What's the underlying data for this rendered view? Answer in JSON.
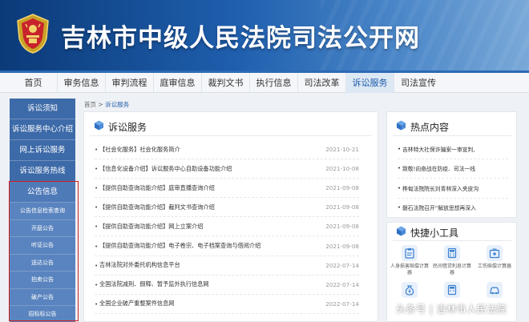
{
  "header": {
    "site_title": "吉林市中级人民法院司法公开网"
  },
  "nav": {
    "items": [
      "首页",
      "审务信息",
      "审判流程",
      "庭审信息",
      "裁判文书",
      "执行信息",
      "司法改革",
      "诉讼服务",
      "司法宣传"
    ],
    "active_index": 7
  },
  "sidebar": {
    "items": [
      "诉讼须知",
      "诉讼服务中心介绍",
      "网上诉讼服务",
      "诉讼服务热线"
    ],
    "section": "公告信息",
    "sub_items": [
      "公告信息检索查询",
      "开庭公告",
      "听证公告",
      "送达公告",
      "拍卖公告",
      "破产公告",
      "招标标公告"
    ]
  },
  "breadcrumb": {
    "home": "首页",
    "separator": ">",
    "current": "诉讼服务"
  },
  "main": {
    "title": "诉讼服务",
    "items": [
      {
        "text": "【社会化服务】社会化服务简介",
        "date": "2021-10-21"
      },
      {
        "text": "【信息化设备介绍】诉讼服务中心自助设备功能介绍",
        "date": "2021-10-08"
      },
      {
        "text": "【提供自助查询功能介绍】庭审直播查询介绍",
        "date": "2021-09-08"
      },
      {
        "text": "【提供自助查询功能介绍】裁判文书查询介绍",
        "date": "2021-09-08"
      },
      {
        "text": "【提供自助查询功能介绍】网上立案介绍",
        "date": "2021-09-08"
      },
      {
        "text": "【提供自助查询功能介绍】电子卷宗、电子档案查询与借阅介绍",
        "date": "2021-09-08"
      },
      {
        "text": "吉林法院对外委托机构信息平台",
        "date": "2022-07-14"
      },
      {
        "text": "全国法院减刑、假释、暂予监外执行信息网",
        "date": "2022-07-14"
      },
      {
        "text": "全国企业破产重整案件信息网",
        "date": "2022-07-14"
      }
    ]
  },
  "hot": {
    "title": "热点内容",
    "items": [
      "吉林特大社保诈骗案一审宣判,",
      "致敬!向奋战在防疫、司法一线",
      "桦甸法院院长刘青林深入夹皮沟",
      "磐石法院召开“解放思想再深入"
    ]
  },
  "tools": {
    "title": "快捷小工具",
    "items": [
      {
        "label": "人身损害赔偿计算器",
        "icon": "clipboard-icon"
      },
      {
        "label": "民间借贷利息计算器",
        "icon": "calculator-icon"
      },
      {
        "label": "工伤赔偿计算器",
        "icon": "medical-kit-icon"
      },
      {
        "label": "",
        "icon": "money-bag-icon"
      },
      {
        "label": "",
        "icon": "calculator-icon"
      },
      {
        "label": "",
        "icon": "car-icon"
      }
    ]
  },
  "watermark": "头条号 | 吉林市人民法院",
  "colors": {
    "banner": "#1f5fae",
    "nav_accent": "#2c6ab5",
    "sidebar": "#3b67a6",
    "highlight": "#d22020",
    "cube": "#3a7fd0"
  }
}
